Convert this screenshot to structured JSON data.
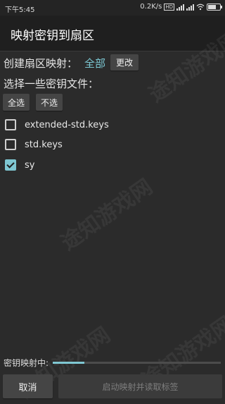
{
  "status_bar": {
    "time": "下午5:45",
    "network_speed": "0.2K/s",
    "hd_badge": "HD",
    "icons": [
      "signal-icon",
      "wifi-icon",
      "battery-icon"
    ]
  },
  "title": "映射密钥到扇区",
  "sector_row": {
    "label": "创建扇区映射：",
    "value": "全部",
    "change_button": "更改"
  },
  "select_prompt": "选择一些密钥文件：",
  "select_all_button": "全选",
  "select_none_button": "不选",
  "key_files": [
    {
      "name": "extended-std.keys",
      "checked": false
    },
    {
      "name": "std.keys",
      "checked": false
    },
    {
      "name": "sy",
      "checked": true
    }
  ],
  "progress": {
    "label": "密钥映射中:",
    "value": 0.19
  },
  "bottom": {
    "cancel_button": "取消",
    "start_button": "启动映射并读取标签"
  },
  "watermark": "途知游戏网",
  "colors": {
    "accent": "#7fc7d2",
    "background": "#2b2b2b",
    "titlebar": "#1f1f1f"
  }
}
